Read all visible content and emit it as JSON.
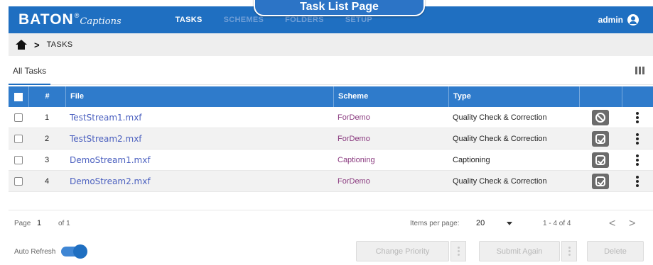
{
  "header": {
    "brand_main": "BATON",
    "brand_sup": "®",
    "brand_sub": "Captions",
    "nav": [
      {
        "label": "TASKS"
      },
      {
        "label": "SCHEMES"
      },
      {
        "label": "FOLDERS"
      },
      {
        "label": "SETUP"
      }
    ],
    "user": "admin",
    "banner": "Task List Page"
  },
  "breadcrumb": {
    "separator": ">",
    "current": "TASKS"
  },
  "tabs": [
    {
      "label": "All Tasks"
    }
  ],
  "table": {
    "columns": {
      "num": "#",
      "file": "File",
      "scheme": "Scheme",
      "type": "Type"
    },
    "rows": [
      {
        "num": "1",
        "file": "TestStream1.mxf",
        "scheme": "ForDemo",
        "type": "Quality Check & Correction",
        "action_icon": "ban-icon"
      },
      {
        "num": "2",
        "file": "TestStream2.mxf",
        "scheme": "ForDemo",
        "type": "Quality Check & Correction",
        "action_icon": "check-icon"
      },
      {
        "num": "3",
        "file": "DemoStream1.mxf",
        "scheme": "Captioning",
        "type": "Captioning",
        "action_icon": "check-icon"
      },
      {
        "num": "4",
        "file": "DemoStream2.mxf",
        "scheme": "ForDemo",
        "type": "Quality Check & Correction",
        "action_icon": "check-icon"
      }
    ]
  },
  "pager": {
    "page_label": "Page",
    "page_value": "1",
    "of_label": "of 1",
    "items_per_page_label": "Items per page:",
    "items_per_page_value": "20",
    "range": "1 - 4 of 4",
    "prev": "<",
    "next": ">"
  },
  "footer": {
    "auto_refresh_label": "Auto Refresh",
    "change_priority": "Change Priority",
    "submit_again": "Submit Again",
    "delete": "Delete"
  },
  "colors": {
    "primary": "#1f6fc1",
    "header_row": "#2f7bcb",
    "file_link": "#4a5fbf",
    "scheme_link": "#8a3a7f"
  }
}
